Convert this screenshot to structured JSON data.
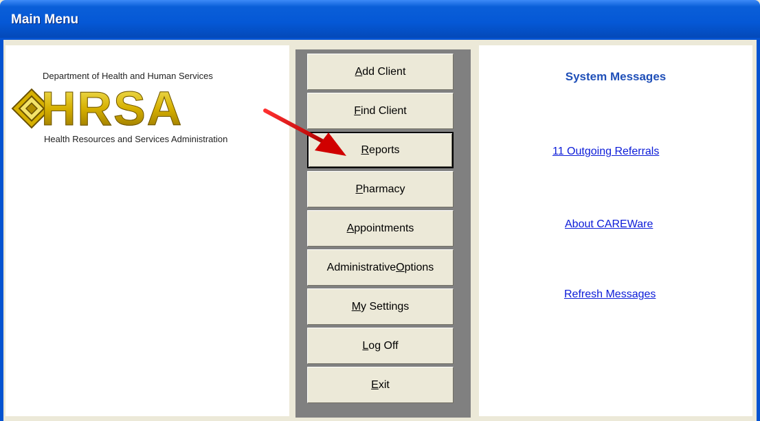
{
  "window": {
    "title": "Main Menu"
  },
  "logo": {
    "org_top": "Department of Health and Human Services",
    "wordmark": "HRSA",
    "org_bottom": "Health Resources and Services Administration"
  },
  "menu": {
    "buttons": [
      {
        "pre": "",
        "key": "A",
        "post": "dd Client"
      },
      {
        "pre": "",
        "key": "F",
        "post": "ind Client"
      },
      {
        "pre": "",
        "key": "R",
        "post": "eports"
      },
      {
        "pre": "",
        "key": "P",
        "post": "harmacy"
      },
      {
        "pre": "",
        "key": "A",
        "post": "ppointments"
      },
      {
        "pre": "Administrative ",
        "key": "O",
        "post": "ptions"
      },
      {
        "pre": "",
        "key": "M",
        "post": "y Settings"
      },
      {
        "pre": "",
        "key": "L",
        "post": "og Off"
      },
      {
        "pre": "",
        "key": "E",
        "post": "xit"
      }
    ],
    "focused_index": 2
  },
  "messages": {
    "heading": "System Messages",
    "links": [
      "11  Outgoing Referrals",
      "About CAREWare",
      "Refresh Messages"
    ]
  },
  "colors": {
    "titlebar": "#0558d6",
    "link": "#0b1bd8",
    "heading": "#1f4fb8",
    "arrow": "#e00000"
  },
  "icons": {
    "arrow": "red-pointer-arrow-icon",
    "logo_mark": "hrsa-diamond-icon"
  }
}
